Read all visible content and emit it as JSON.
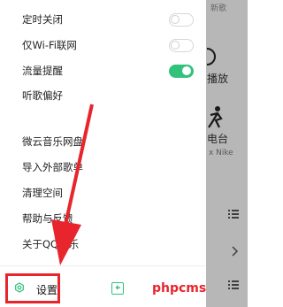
{
  "background": {
    "top_text": "新歌",
    "items": [
      {
        "label": "播放"
      },
      {
        "label": "电台",
        "sub": "x Nike"
      }
    ],
    "icons": [
      "list-icon",
      "list-icon",
      "chevron-right-icon",
      "list-icon"
    ]
  },
  "drawer": {
    "settings": [
      {
        "label": "定时关闭",
        "toggle": false
      },
      {
        "label": "仅Wi-Fi联网",
        "toggle": false
      },
      {
        "label": "流量提醒",
        "toggle": true
      },
      {
        "label": "听歌偏好"
      }
    ],
    "links": [
      {
        "label": "微云音乐网盘"
      },
      {
        "label": "导入外部歌单"
      },
      {
        "label": "清理空间"
      },
      {
        "label": "帮助与反馈"
      },
      {
        "label": "关于QQ音乐"
      }
    ],
    "footer": {
      "settings_label": "设置"
    }
  },
  "colors": {
    "accent": "#31c27c",
    "annotation": "#e8252d"
  },
  "watermark": "phpcms"
}
